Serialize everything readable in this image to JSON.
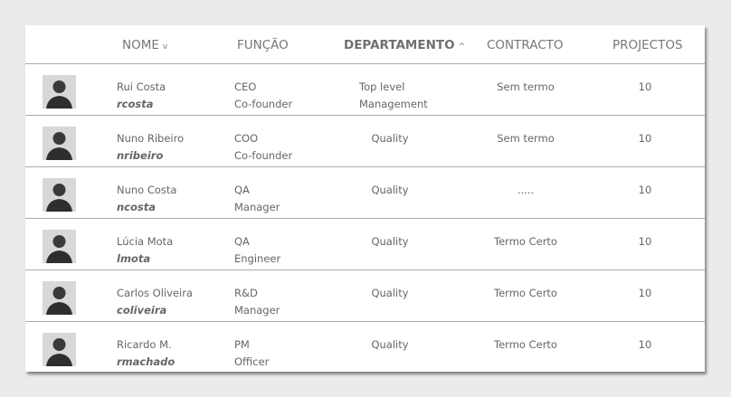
{
  "headers": {
    "nome": "NOME",
    "nome_sort": "v",
    "funcao": "FUNÇÃO",
    "departamento": "DEPARTAMENTO",
    "departamento_sort": "^",
    "contracto": "CONTRACTO",
    "projectos": "PROJECTOS"
  },
  "rows": [
    {
      "name": "Rui Costa",
      "user": "rcosta",
      "role1": "CEO",
      "role2": "Co-founder",
      "dept1": "Top level",
      "dept2": "Management",
      "contract": "Sem termo",
      "projects": "10",
      "avatar": "avatar-photo"
    },
    {
      "name": "Nuno Ribeiro",
      "user": "nribeiro",
      "role1": "COO",
      "role2": "Co-founder",
      "dept1": "Quality",
      "dept2": "",
      "contract": "Sem termo",
      "projects": "10",
      "avatar": "avatar-photo"
    },
    {
      "name": "Nuno Costa",
      "user": "ncosta",
      "role1": "QA",
      "role2": "Manager",
      "dept1": "Quality",
      "dept2": "",
      "contract": ".....",
      "projects": "10",
      "avatar": "avatar-photo"
    },
    {
      "name": "Lúcia Mota",
      "user": "lmota",
      "role1": "QA",
      "role2": "Engineer",
      "dept1": "Quality",
      "dept2": "",
      "contract": "Termo Certo",
      "projects": "10",
      "avatar": "avatar-photo"
    },
    {
      "name": "Carlos Oliveira",
      "user": "coliveira",
      "role1": "R&D",
      "role2": "Manager",
      "dept1": "Quality",
      "dept2": "",
      "contract": "Termo Certo",
      "projects": "10",
      "avatar": "avatar-photo"
    },
    {
      "name": "Ricardo M.",
      "user": "rmachado",
      "role1": "PM",
      "role2": "Officer",
      "dept1": "Quality",
      "dept2": "",
      "contract": "Termo Certo",
      "projects": "10",
      "avatar": "avatar-photo"
    }
  ]
}
